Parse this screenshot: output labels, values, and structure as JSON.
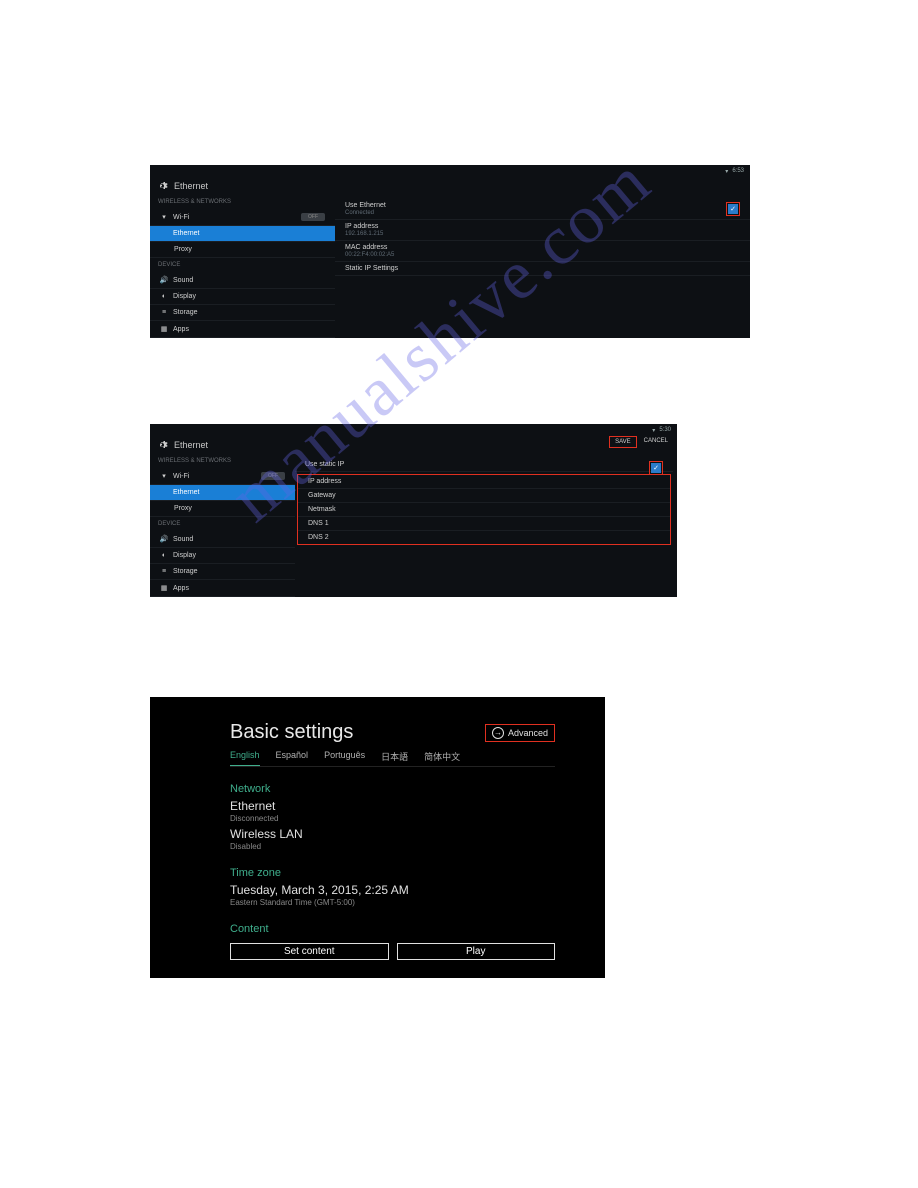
{
  "watermark": "manualshive.com",
  "panel1": {
    "title": "Ethernet",
    "status_time": "6:53",
    "sidebar": {
      "section1": "WIRELESS & NETWORKS",
      "items1": [
        {
          "icon": "wifi-icon",
          "label": "Wi-Fi",
          "toggle": "OFF"
        },
        {
          "icon": "",
          "label": "Ethernet",
          "selected": true
        },
        {
          "icon": "",
          "label": "Proxy",
          "sub": true
        }
      ],
      "section2": "DEVICE",
      "items2": [
        {
          "icon": "speaker-icon",
          "label": "Sound"
        },
        {
          "icon": "brightness-icon",
          "label": "Display"
        },
        {
          "icon": "storage-icon",
          "label": "Storage"
        },
        {
          "icon": "apps-icon",
          "label": "Apps"
        }
      ]
    },
    "main": [
      {
        "label": "Use Ethernet",
        "sub": "Connected",
        "checked": true
      },
      {
        "label": "IP address",
        "sub": "192.168.1.215"
      },
      {
        "label": "MAC address",
        "sub": "00:22:F4:00:02:A5"
      },
      {
        "label": "Static IP Settings"
      }
    ]
  },
  "panel2": {
    "title": "Ethernet",
    "status_time": "5:30",
    "save": "SAVE",
    "cancel": "CANCEL",
    "sidebar": {
      "section1": "WIRELESS & NETWORKS",
      "items1": [
        {
          "icon": "wifi-icon",
          "label": "Wi-Fi",
          "toggle": "OFF"
        },
        {
          "icon": "",
          "label": "Ethernet",
          "selected": true
        },
        {
          "icon": "",
          "label": "Proxy",
          "sub": true
        }
      ],
      "section2": "DEVICE",
      "items2": [
        {
          "icon": "speaker-icon",
          "label": "Sound"
        },
        {
          "icon": "brightness-icon",
          "label": "Display"
        },
        {
          "icon": "storage-icon",
          "label": "Storage"
        },
        {
          "icon": "apps-icon",
          "label": "Apps"
        }
      ]
    },
    "main_first": {
      "label": "Use static IP",
      "checked": true
    },
    "main_red": [
      {
        "label": "IP address"
      },
      {
        "label": "Gateway"
      },
      {
        "label": "Netmask"
      },
      {
        "label": "DNS 1"
      },
      {
        "label": "DNS 2"
      }
    ]
  },
  "panel3": {
    "title": "Basic settings",
    "advanced": "Advanced",
    "tabs": [
      "English",
      "Español",
      "Português",
      "日本語",
      "简体中文"
    ],
    "active_tab": 0,
    "network_section": "Network",
    "ethernet": {
      "label": "Ethernet",
      "status": "Disconnected"
    },
    "wlan": {
      "label": "Wireless LAN",
      "status": "Disabled"
    },
    "timezone_section": "Time zone",
    "datetime": {
      "label": "Tuesday, March 3, 2015, 2:25 AM",
      "status": "Eastern Standard Time (GMT-5:00)"
    },
    "content_section": "Content",
    "buttons": [
      "Set content",
      "Play"
    ]
  }
}
